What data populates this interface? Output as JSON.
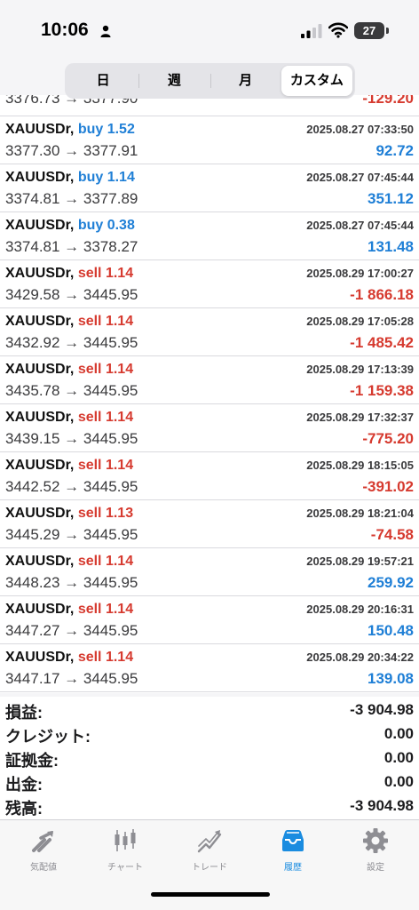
{
  "status": {
    "time": "10:06",
    "battery": "27"
  },
  "periods": [
    "日",
    "週",
    "月",
    "カスタム"
  ],
  "deals_partial": {
    "prices": "3376.73 → 3377.90",
    "profit": "-129.20"
  },
  "deals": [
    {
      "symbol": "XAUUSDr",
      "sep": ",",
      "side": "buy",
      "volume": "buy 1.52",
      "date": "2025.08.27 07:33:50",
      "prices": "3377.30 → 3377.91",
      "profit": "92.72",
      "sign": "pos"
    },
    {
      "symbol": "XAUUSDr",
      "sep": ",",
      "side": "buy",
      "volume": "buy 1.14",
      "date": "2025.08.27 07:45:44",
      "prices": "3374.81 → 3377.89",
      "profit": "351.12",
      "sign": "pos"
    },
    {
      "symbol": "XAUUSDr",
      "sep": ",",
      "side": "buy",
      "volume": "buy 0.38",
      "date": "2025.08.27 07:45:44",
      "prices": "3374.81 → 3378.27",
      "profit": "131.48",
      "sign": "pos"
    },
    {
      "symbol": "XAUUSDr",
      "sep": ",",
      "side": "sell",
      "volume": "sell 1.14",
      "date": "2025.08.29 17:00:27",
      "prices": "3429.58 → 3445.95",
      "profit": "-1 866.18",
      "sign": "neg"
    },
    {
      "symbol": "XAUUSDr",
      "sep": ",",
      "side": "sell",
      "volume": "sell 1.14",
      "date": "2025.08.29 17:05:28",
      "prices": "3432.92 → 3445.95",
      "profit": "-1 485.42",
      "sign": "neg"
    },
    {
      "symbol": "XAUUSDr",
      "sep": ",",
      "side": "sell",
      "volume": "sell 1.14",
      "date": "2025.08.29 17:13:39",
      "prices": "3435.78 → 3445.95",
      "profit": "-1 159.38",
      "sign": "neg"
    },
    {
      "symbol": "XAUUSDr",
      "sep": ",",
      "side": "sell",
      "volume": "sell 1.14",
      "date": "2025.08.29 17:32:37",
      "prices": "3439.15 → 3445.95",
      "profit": "-775.20",
      "sign": "neg"
    },
    {
      "symbol": "XAUUSDr",
      "sep": ",",
      "side": "sell",
      "volume": "sell 1.14",
      "date": "2025.08.29 18:15:05",
      "prices": "3442.52 → 3445.95",
      "profit": "-391.02",
      "sign": "neg"
    },
    {
      "symbol": "XAUUSDr",
      "sep": ",",
      "side": "sell",
      "volume": "sell 1.13",
      "date": "2025.08.29 18:21:04",
      "prices": "3445.29 → 3445.95",
      "profit": "-74.58",
      "sign": "neg"
    },
    {
      "symbol": "XAUUSDr",
      "sep": ",",
      "side": "sell",
      "volume": "sell 1.14",
      "date": "2025.08.29 19:57:21",
      "prices": "3448.23 → 3445.95",
      "profit": "259.92",
      "sign": "pos"
    },
    {
      "symbol": "XAUUSDr",
      "sep": ",",
      "side": "sell",
      "volume": "sell 1.14",
      "date": "2025.08.29 20:16:31",
      "prices": "3447.27 → 3445.95",
      "profit": "150.48",
      "sign": "pos"
    },
    {
      "symbol": "XAUUSDr",
      "sep": ",",
      "side": "sell",
      "volume": "sell 1.14",
      "date": "2025.08.29 20:34:22",
      "prices": "3447.17 → 3445.95",
      "profit": "139.08",
      "sign": "pos"
    }
  ],
  "summary": [
    {
      "label": "損益:",
      "value": "-3 904.98"
    },
    {
      "label": "クレジット:",
      "value": "0.00"
    },
    {
      "label": "証拠金:",
      "value": "0.00"
    },
    {
      "label": "出金:",
      "value": "0.00"
    },
    {
      "label": "残高:",
      "value": "-3 904.98"
    }
  ],
  "tabs": [
    {
      "label": "気配値",
      "icon": "quotes-icon"
    },
    {
      "label": "チャート",
      "icon": "chart-icon"
    },
    {
      "label": "トレード",
      "icon": "trade-icon"
    },
    {
      "label": "履歴",
      "icon": "history-icon",
      "active": true
    },
    {
      "label": "設定",
      "icon": "settings-icon"
    }
  ],
  "colors": {
    "buy": "#1f7fd6",
    "sell": "#d63a2f",
    "active_tab": "#1a8ce0"
  }
}
